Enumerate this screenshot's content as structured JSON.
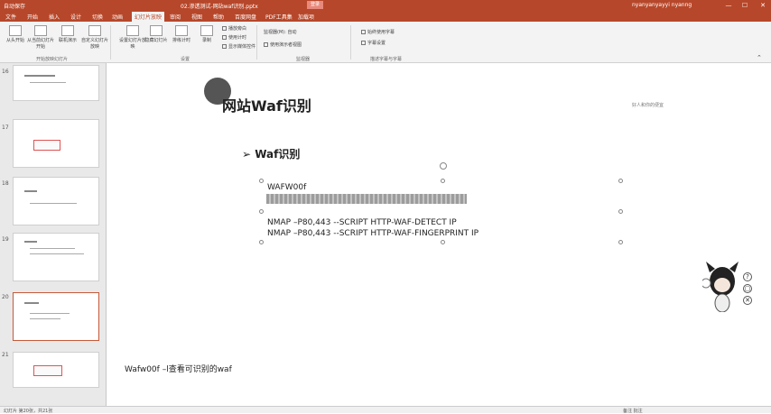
{
  "titlebar": {
    "autosave": "自动保存",
    "doc_title": "02.渗透测试-网站waf识别.pptx",
    "badge": "登录",
    "user": "nyanyanyayyi nyanng",
    "minimize": "—",
    "maximize": "☐",
    "close": "✕"
  },
  "tabs": [
    "文件",
    "开始",
    "插入",
    "设计",
    "切换",
    "动画",
    "幻灯片放映",
    "审阅",
    "视图",
    "帮助",
    "百度网盘",
    "PDF工具集",
    "加载项"
  ],
  "active_tab_index": 6,
  "ribbon": {
    "buttons": [
      "从头开始",
      "从当前幻灯片开始",
      "联机演示",
      "自定义幻灯片放映",
      "设置幻灯片放映",
      "隐藏幻灯片",
      "排练计时",
      "录制"
    ],
    "checks": [
      "播放旁白",
      "使用计时",
      "显示媒体控件"
    ],
    "monitor_label": "监视器(M): 自动",
    "presenter_view": "使用演示者视图",
    "subtitle_always": "始终使用字幕",
    "subtitle_settings": "字幕设置",
    "groups": [
      "开始放映幻灯片",
      "设置",
      "监视器",
      "描述字幕与字幕"
    ]
  },
  "thumbnails": [
    {
      "num": "16"
    },
    {
      "num": "17"
    },
    {
      "num": "18"
    },
    {
      "num": "19"
    },
    {
      "num": "20",
      "selected": true
    },
    {
      "num": "21"
    }
  ],
  "slide": {
    "heading": "网站Waf识别",
    "corner_note": "好人和你的便宜",
    "bullet_title": "Waf识别",
    "line1": "WAFW00f",
    "cmd1": "NMAP –P80,443 --SCRIPT HTTP-WAF-DETECT IP",
    "cmd2": "NMAP –P80,443 --SCRIPT HTTP-WAF-FINGERPRINT IP",
    "bottom_note": "Wafw00f –l查看可识别的waf"
  },
  "mascot_buttons": [
    "?",
    "▢",
    "✕"
  ],
  "statusbar": {
    "left": "幻灯片 第20张，共21张",
    "right": "备注  批注"
  }
}
